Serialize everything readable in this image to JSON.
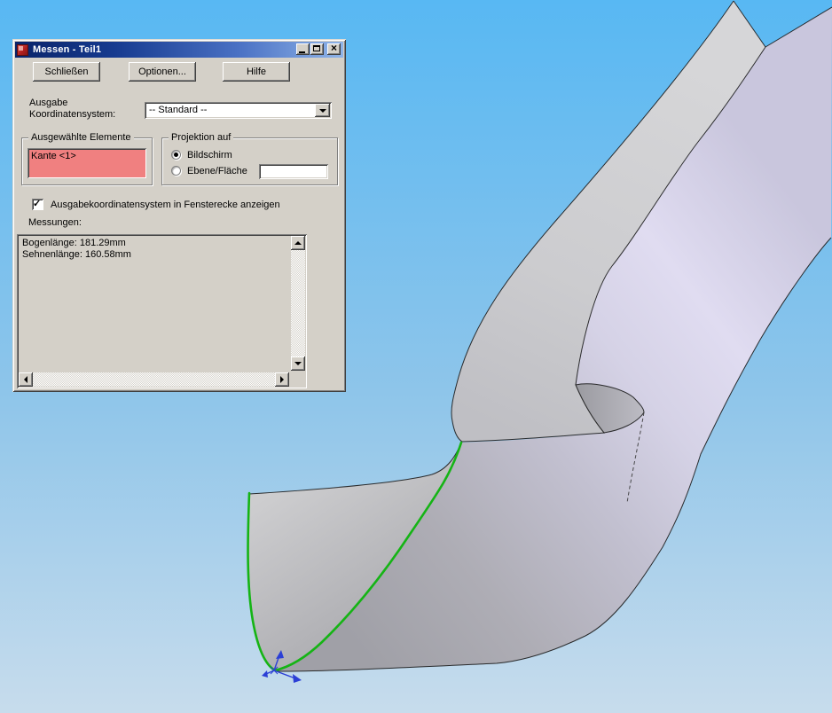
{
  "window": {
    "title": "Messen - Teil1",
    "app_icon": "solidworks-cube-icon",
    "action_buttons": [
      {
        "label": "Schließen"
      },
      {
        "label": "Optionen..."
      },
      {
        "label": "Hilfe"
      }
    ],
    "output_coord": {
      "label_line1": "Ausgabe",
      "label_line2": "Koordinatensystem:",
      "combo_value": "-- Standard --"
    },
    "selected_elements": {
      "title": "Ausgewählte Elemente",
      "items": [
        "Kante <1>"
      ],
      "highlight_color": "#F08080"
    },
    "projection": {
      "title": "Projektion auf",
      "options": [
        {
          "label": "Bildschirm",
          "selected": true
        },
        {
          "label": "Ebene/Fläche",
          "selected": false
        }
      ],
      "plane_field_value": ""
    },
    "corner_checkbox": {
      "label": "Ausgabekoordinatensystem in Fensterecke anzeigen",
      "checked": true,
      "check_glyph": "✓"
    },
    "measurements": {
      "label": "Messungen:",
      "lines": [
        "Bogenlänge: 181.29mm",
        "Sehnenlänge: 160.58mm"
      ]
    }
  },
  "viewport": {
    "selected_edge_color": "#15B415",
    "triad_color": "#2B3FD6",
    "sky_top": "#58B8F3",
    "sky_mid": "#8EC5EA",
    "sky_bottom": "#C7DCEC",
    "titlebar_left": "#0A246A",
    "titlebar_right": "#8FB4E8",
    "dialog_background": "#D4D0C8"
  }
}
